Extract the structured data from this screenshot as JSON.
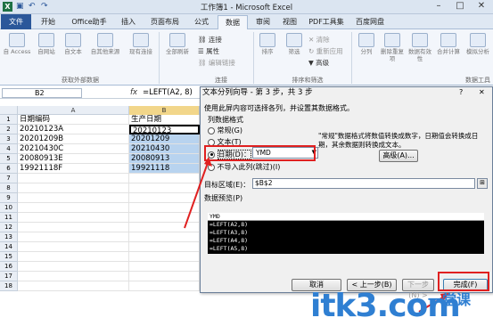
{
  "window": {
    "title": "工作簿1 - Microsoft Excel"
  },
  "tabs": [
    "文件",
    "开始",
    "Office助手",
    "插入",
    "页面布局",
    "公式",
    "数据",
    "审阅",
    "视图",
    "PDF工具集",
    "百度网盘"
  ],
  "ribbon": {
    "group_external": "获取外部数据",
    "group_connect": "连接",
    "group_sort": "排序和筛选",
    "group_tools": "数据工具",
    "buttons": [
      "自 Access",
      "自网站",
      "自文本",
      "自其他来源",
      "现有连接",
      "全部刷新",
      "排序",
      "筛选",
      "分列",
      "删除重复项",
      "数据有效性",
      "合并计算",
      "模拟分析"
    ],
    "small": [
      "连接",
      "属性",
      "编辑链接",
      "清除",
      "重新应用",
      "高级"
    ]
  },
  "namebox": "B2",
  "formula": "=LEFT(A2, 8)",
  "columns": [
    "A",
    "B"
  ],
  "rows": [
    {
      "n": "1",
      "a": "日期编码",
      "b": "生产日期"
    },
    {
      "n": "2",
      "a": "20210123A",
      "b": "20210123"
    },
    {
      "n": "3",
      "a": "20201209B",
      "b": "20201209"
    },
    {
      "n": "4",
      "a": "20210430C",
      "b": "20210430"
    },
    {
      "n": "5",
      "a": "20080913E",
      "b": "20080913"
    },
    {
      "n": "6",
      "a": "19921118F",
      "b": "19921118"
    },
    {
      "n": "7",
      "a": "",
      "b": ""
    },
    {
      "n": "8",
      "a": "",
      "b": ""
    },
    {
      "n": "9",
      "a": "",
      "b": ""
    },
    {
      "n": "10",
      "a": "",
      "b": ""
    },
    {
      "n": "11",
      "a": "",
      "b": ""
    },
    {
      "n": "12",
      "a": "",
      "b": ""
    },
    {
      "n": "13",
      "a": "",
      "b": ""
    },
    {
      "n": "14",
      "a": "",
      "b": ""
    },
    {
      "n": "15",
      "a": "",
      "b": ""
    },
    {
      "n": "16",
      "a": "",
      "b": ""
    },
    {
      "n": "17",
      "a": "",
      "b": ""
    },
    {
      "n": "18",
      "a": "",
      "b": ""
    }
  ],
  "dialog": {
    "title": "文本分列向导 - 第 3 步，共 3 步",
    "help": "?",
    "intro": "使用此屏内容可选择各列，并设置其数据格式。",
    "format_label": "列数据格式",
    "opt_general": "常规(G)",
    "opt_text": "文本(T)",
    "opt_date": "日期(D)：",
    "date_format": "YMD",
    "opt_skip": "不导入此列(跳过)(I)",
    "note": "\"常规\"数据格式将数值转换成数字，日期值会转换成日期，其余数据则转换成文本。",
    "advanced": "高级(A)...",
    "target_label": "目标区域(E)：",
    "target_value": "$B$2",
    "preview_label": "数据预览(P)",
    "preview": [
      "YMD",
      "=LEFT(A2,8)",
      "=LEFT(A3,8)",
      "=LEFT(A4,8)",
      "=LEFT(A5,8)"
    ],
    "cancel": "取消",
    "back": "< 上一步(B)",
    "next": "下一步(N) >",
    "finish": "完成(F)"
  },
  "watermark": {
    "main": "itk3.com",
    "sub": "一堂课"
  }
}
